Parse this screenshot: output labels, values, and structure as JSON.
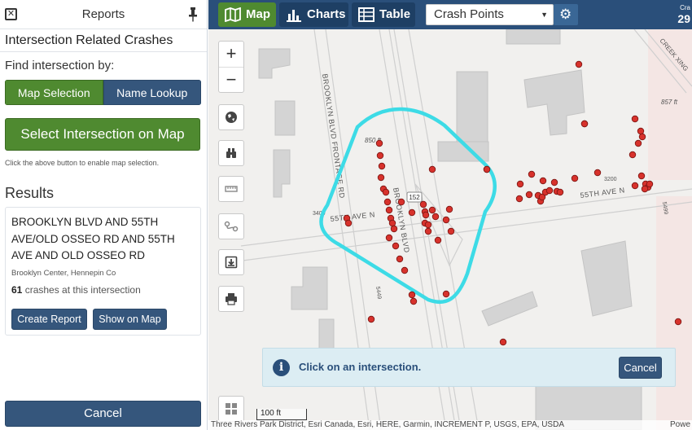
{
  "panel": {
    "title": "Reports",
    "section_title": "Intersection Related Crashes",
    "find_label": "Find intersection by:",
    "toggle": {
      "map_selection": "Map Selection",
      "name_lookup": "Name Lookup",
      "active": "Map Selection"
    },
    "select_button": "Select Intersection on Map",
    "hint": "Click the above button to enable map selection.",
    "results_title": "Results",
    "result": {
      "name": "BROOKLYN BLVD AND 55TH AVE/OLD OSSEO RD AND 55TH AVE AND OLD OSSEO RD",
      "place": "Brooklyn Center, Hennepin Co",
      "count": "61",
      "count_suffix": "crashes at this intersection",
      "create_report": "Create Report",
      "show_on_map": "Show on Map"
    },
    "cancel": "Cancel"
  },
  "topbar": {
    "tabs": {
      "map": "Map",
      "charts": "Charts",
      "table": "Table"
    },
    "active_tab": "Map",
    "layer_select": {
      "value": "Crash Points"
    },
    "corner_label": "Cra",
    "corner_value": "29"
  },
  "map": {
    "road_labels": {
      "brooklyn_frontage": "BROOKLYN BLVD FRONTAGE RD",
      "brooklyn_blvd": "BROOKLYN BLVD",
      "ave_55_west": "55TH AVE N",
      "ave_55_east": "55TH AVE N",
      "creek": "CREEK XING",
      "shield": "152"
    },
    "elevation_labels": {
      "e1": "850 ft",
      "e2": "857 ft",
      "e3": "3200",
      "e4": "3400",
      "e5": "5449",
      "e6": "5499"
    },
    "notice": {
      "message": "Click on an intersection.",
      "cancel": "Cancel"
    },
    "scale": "100 ft",
    "attribution": "Three Rivers Park District, Esri Canada, Esri, HERE, Garmin, INCREMENT P, USGS, EPA, USDA",
    "powered": "Powe",
    "crash_point_color": "#d7322c",
    "selection_color": "#3ddbe6"
  }
}
